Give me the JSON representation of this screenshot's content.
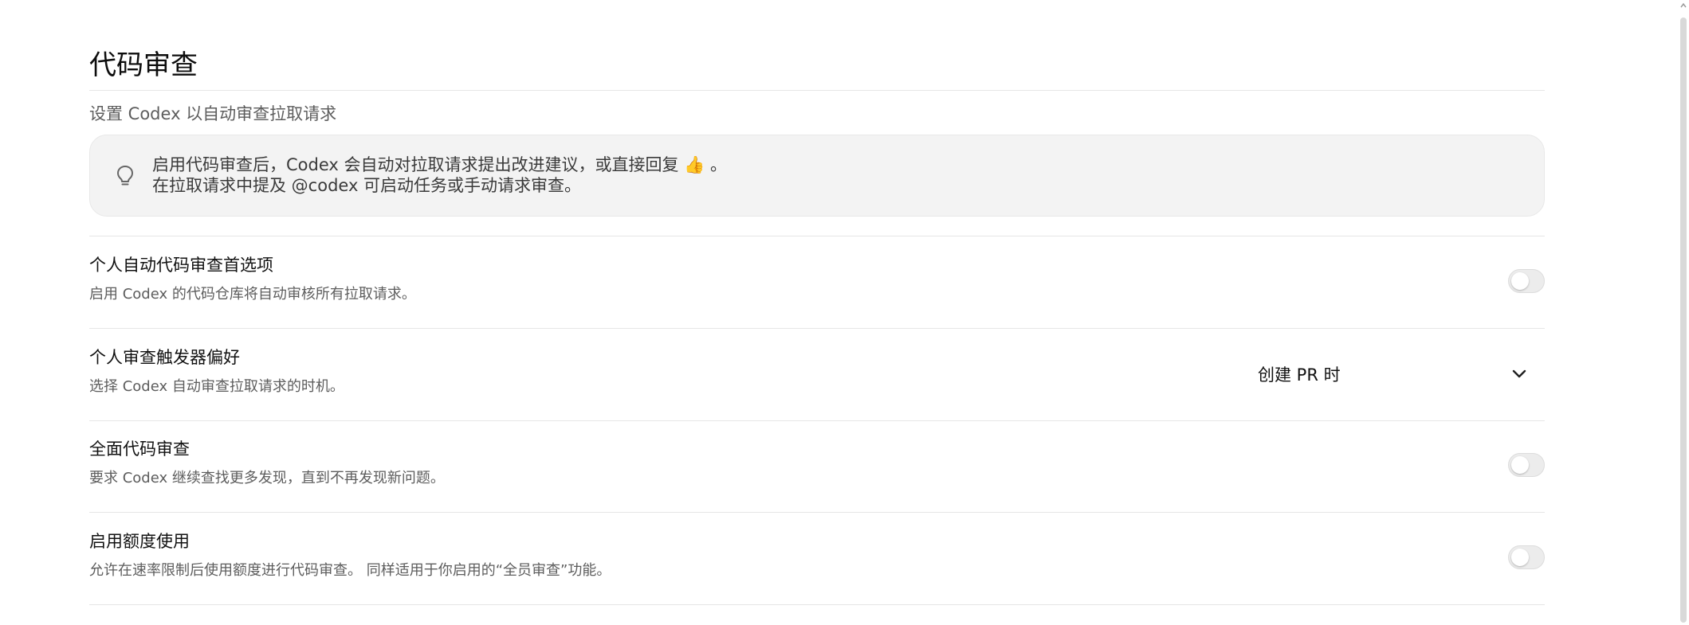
{
  "page": {
    "title": "代码审查",
    "subtitle": "设置 Codex 以自动审查拉取请求"
  },
  "info_callout": {
    "icon": "lightbulb-icon",
    "line1": "启用代码审查后，Codex 会自动对拉取请求提出改进建议，或直接回复 👍 。",
    "line2": "在拉取请求中提及 @codex 可启动任务或手动请求审查。"
  },
  "settings": [
    {
      "title": "个人自动代码审查首选项",
      "description": "启用 Codex 的代码仓库将自动审核所有拉取请求。",
      "control": "toggle",
      "enabled": false
    },
    {
      "title": "个人审查触发器偏好",
      "description": "选择 Codex 自动审查拉取请求的时机。",
      "control": "select",
      "selected_value": "创建 PR 时"
    },
    {
      "title": "全面代码审查",
      "description": "要求 Codex 继续查找更多发现，直到不再发现新问题。",
      "control": "toggle",
      "enabled": false
    },
    {
      "title": "启用额度使用",
      "description": "允许在速率限制后使用额度进行代码审查。 同样适用于你启用的“全员审查”功能。",
      "control": "toggle",
      "enabled": false
    }
  ],
  "colors": {
    "toggle_off_track": "#ececec",
    "callout_background": "#f3f3f3",
    "divider": "#e6e6e6"
  }
}
